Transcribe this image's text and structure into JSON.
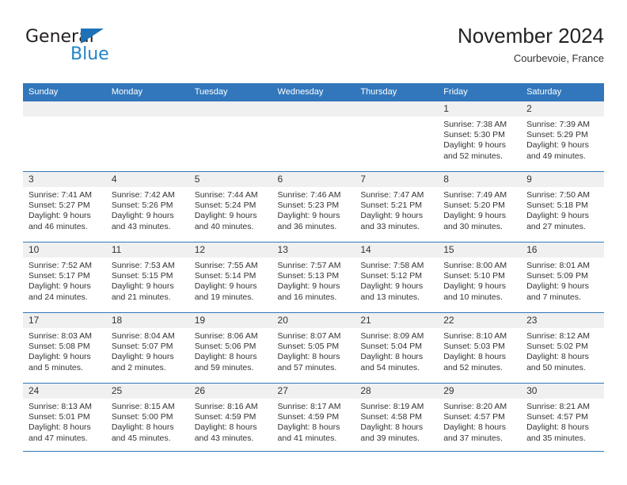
{
  "brand": {
    "name_part1": "General",
    "name_part2": "Blue",
    "triangle_color": "#1d71b8",
    "blue_color": "#2384c6"
  },
  "header": {
    "title": "November 2024",
    "location": "Courbevoie, France"
  },
  "theme": {
    "header_bg": "#3277bc",
    "daynum_bg": "#f0f0f0",
    "text": "#333333"
  },
  "weekday_headers": [
    "Sunday",
    "Monday",
    "Tuesday",
    "Wednesday",
    "Thursday",
    "Friday",
    "Saturday"
  ],
  "weeks": [
    [
      {
        "day": "",
        "empty": true,
        "sunrise": "",
        "sunset": "",
        "daylight1": "",
        "daylight2": ""
      },
      {
        "day": "",
        "empty": true,
        "sunrise": "",
        "sunset": "",
        "daylight1": "",
        "daylight2": ""
      },
      {
        "day": "",
        "empty": true,
        "sunrise": "",
        "sunset": "",
        "daylight1": "",
        "daylight2": ""
      },
      {
        "day": "",
        "empty": true,
        "sunrise": "",
        "sunset": "",
        "daylight1": "",
        "daylight2": ""
      },
      {
        "day": "",
        "empty": true,
        "sunrise": "",
        "sunset": "",
        "daylight1": "",
        "daylight2": ""
      },
      {
        "day": "1",
        "empty": false,
        "sunrise": "Sunrise: 7:38 AM",
        "sunset": "Sunset: 5:30 PM",
        "daylight1": "Daylight: 9 hours",
        "daylight2": "and 52 minutes."
      },
      {
        "day": "2",
        "empty": false,
        "sunrise": "Sunrise: 7:39 AM",
        "sunset": "Sunset: 5:29 PM",
        "daylight1": "Daylight: 9 hours",
        "daylight2": "and 49 minutes."
      }
    ],
    [
      {
        "day": "3",
        "empty": false,
        "sunrise": "Sunrise: 7:41 AM",
        "sunset": "Sunset: 5:27 PM",
        "daylight1": "Daylight: 9 hours",
        "daylight2": "and 46 minutes."
      },
      {
        "day": "4",
        "empty": false,
        "sunrise": "Sunrise: 7:42 AM",
        "sunset": "Sunset: 5:26 PM",
        "daylight1": "Daylight: 9 hours",
        "daylight2": "and 43 minutes."
      },
      {
        "day": "5",
        "empty": false,
        "sunrise": "Sunrise: 7:44 AM",
        "sunset": "Sunset: 5:24 PM",
        "daylight1": "Daylight: 9 hours",
        "daylight2": "and 40 minutes."
      },
      {
        "day": "6",
        "empty": false,
        "sunrise": "Sunrise: 7:46 AM",
        "sunset": "Sunset: 5:23 PM",
        "daylight1": "Daylight: 9 hours",
        "daylight2": "and 36 minutes."
      },
      {
        "day": "7",
        "empty": false,
        "sunrise": "Sunrise: 7:47 AM",
        "sunset": "Sunset: 5:21 PM",
        "daylight1": "Daylight: 9 hours",
        "daylight2": "and 33 minutes."
      },
      {
        "day": "8",
        "empty": false,
        "sunrise": "Sunrise: 7:49 AM",
        "sunset": "Sunset: 5:20 PM",
        "daylight1": "Daylight: 9 hours",
        "daylight2": "and 30 minutes."
      },
      {
        "day": "9",
        "empty": false,
        "sunrise": "Sunrise: 7:50 AM",
        "sunset": "Sunset: 5:18 PM",
        "daylight1": "Daylight: 9 hours",
        "daylight2": "and 27 minutes."
      }
    ],
    [
      {
        "day": "10",
        "empty": false,
        "sunrise": "Sunrise: 7:52 AM",
        "sunset": "Sunset: 5:17 PM",
        "daylight1": "Daylight: 9 hours",
        "daylight2": "and 24 minutes."
      },
      {
        "day": "11",
        "empty": false,
        "sunrise": "Sunrise: 7:53 AM",
        "sunset": "Sunset: 5:15 PM",
        "daylight1": "Daylight: 9 hours",
        "daylight2": "and 21 minutes."
      },
      {
        "day": "12",
        "empty": false,
        "sunrise": "Sunrise: 7:55 AM",
        "sunset": "Sunset: 5:14 PM",
        "daylight1": "Daylight: 9 hours",
        "daylight2": "and 19 minutes."
      },
      {
        "day": "13",
        "empty": false,
        "sunrise": "Sunrise: 7:57 AM",
        "sunset": "Sunset: 5:13 PM",
        "daylight1": "Daylight: 9 hours",
        "daylight2": "and 16 minutes."
      },
      {
        "day": "14",
        "empty": false,
        "sunrise": "Sunrise: 7:58 AM",
        "sunset": "Sunset: 5:12 PM",
        "daylight1": "Daylight: 9 hours",
        "daylight2": "and 13 minutes."
      },
      {
        "day": "15",
        "empty": false,
        "sunrise": "Sunrise: 8:00 AM",
        "sunset": "Sunset: 5:10 PM",
        "daylight1": "Daylight: 9 hours",
        "daylight2": "and 10 minutes."
      },
      {
        "day": "16",
        "empty": false,
        "sunrise": "Sunrise: 8:01 AM",
        "sunset": "Sunset: 5:09 PM",
        "daylight1": "Daylight: 9 hours",
        "daylight2": "and 7 minutes."
      }
    ],
    [
      {
        "day": "17",
        "empty": false,
        "sunrise": "Sunrise: 8:03 AM",
        "sunset": "Sunset: 5:08 PM",
        "daylight1": "Daylight: 9 hours",
        "daylight2": "and 5 minutes."
      },
      {
        "day": "18",
        "empty": false,
        "sunrise": "Sunrise: 8:04 AM",
        "sunset": "Sunset: 5:07 PM",
        "daylight1": "Daylight: 9 hours",
        "daylight2": "and 2 minutes."
      },
      {
        "day": "19",
        "empty": false,
        "sunrise": "Sunrise: 8:06 AM",
        "sunset": "Sunset: 5:06 PM",
        "daylight1": "Daylight: 8 hours",
        "daylight2": "and 59 minutes."
      },
      {
        "day": "20",
        "empty": false,
        "sunrise": "Sunrise: 8:07 AM",
        "sunset": "Sunset: 5:05 PM",
        "daylight1": "Daylight: 8 hours",
        "daylight2": "and 57 minutes."
      },
      {
        "day": "21",
        "empty": false,
        "sunrise": "Sunrise: 8:09 AM",
        "sunset": "Sunset: 5:04 PM",
        "daylight1": "Daylight: 8 hours",
        "daylight2": "and 54 minutes."
      },
      {
        "day": "22",
        "empty": false,
        "sunrise": "Sunrise: 8:10 AM",
        "sunset": "Sunset: 5:03 PM",
        "daylight1": "Daylight: 8 hours",
        "daylight2": "and 52 minutes."
      },
      {
        "day": "23",
        "empty": false,
        "sunrise": "Sunrise: 8:12 AM",
        "sunset": "Sunset: 5:02 PM",
        "daylight1": "Daylight: 8 hours",
        "daylight2": "and 50 minutes."
      }
    ],
    [
      {
        "day": "24",
        "empty": false,
        "sunrise": "Sunrise: 8:13 AM",
        "sunset": "Sunset: 5:01 PM",
        "daylight1": "Daylight: 8 hours",
        "daylight2": "and 47 minutes."
      },
      {
        "day": "25",
        "empty": false,
        "sunrise": "Sunrise: 8:15 AM",
        "sunset": "Sunset: 5:00 PM",
        "daylight1": "Daylight: 8 hours",
        "daylight2": "and 45 minutes."
      },
      {
        "day": "26",
        "empty": false,
        "sunrise": "Sunrise: 8:16 AM",
        "sunset": "Sunset: 4:59 PM",
        "daylight1": "Daylight: 8 hours",
        "daylight2": "and 43 minutes."
      },
      {
        "day": "27",
        "empty": false,
        "sunrise": "Sunrise: 8:17 AM",
        "sunset": "Sunset: 4:59 PM",
        "daylight1": "Daylight: 8 hours",
        "daylight2": "and 41 minutes."
      },
      {
        "day": "28",
        "empty": false,
        "sunrise": "Sunrise: 8:19 AM",
        "sunset": "Sunset: 4:58 PM",
        "daylight1": "Daylight: 8 hours",
        "daylight2": "and 39 minutes."
      },
      {
        "day": "29",
        "empty": false,
        "sunrise": "Sunrise: 8:20 AM",
        "sunset": "Sunset: 4:57 PM",
        "daylight1": "Daylight: 8 hours",
        "daylight2": "and 37 minutes."
      },
      {
        "day": "30",
        "empty": false,
        "sunrise": "Sunrise: 8:21 AM",
        "sunset": "Sunset: 4:57 PM",
        "daylight1": "Daylight: 8 hours",
        "daylight2": "and 35 minutes."
      }
    ]
  ]
}
